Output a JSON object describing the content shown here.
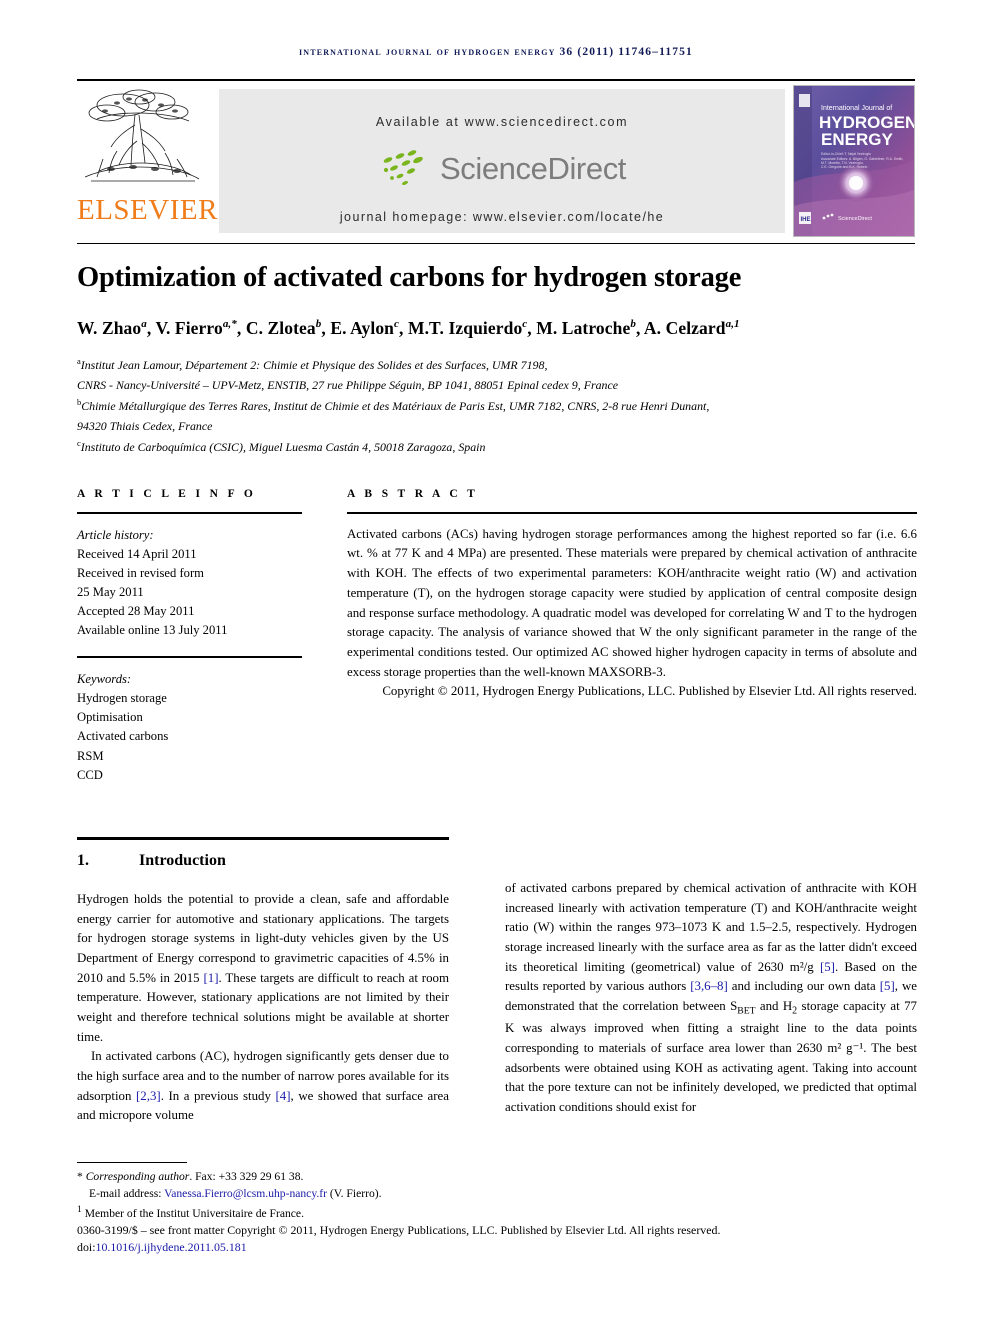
{
  "running_head": "International Journal of Hydrogen Energy 36 (2011) 11746–11751",
  "masthead": {
    "publisher": "ELSEVIER",
    "available_at": "Available at www.sciencedirect.com",
    "sciencedirect": "ScienceDirect",
    "journal_homepage": "journal homepage: www.elsevier.com/locate/he",
    "cover": {
      "line1": "International Journal of",
      "line2": "HYDROGEN",
      "line3": "ENERGY",
      "editor_label": "Editor-in-Chief:",
      "editor": "T. Nejat Veziroglu",
      "assoc_label": "Associate Editors:",
      "assoc": "A. Bilgen, G. Gahleitner, R.A. Smith, M.T. Moretto, T.N. Veziroglu, C.E. Gregoire and B.K. Rebelo",
      "sd_mark": "ScienceDirect"
    }
  },
  "colors": {
    "elsevier_orange": "#f07d1a",
    "sciencedirect_green": "#7ab51d",
    "sciencedirect_gray": "#7d7d7d",
    "link_blue": "#1a1aa8",
    "running_head_navy": "#101a57",
    "banner_gray": "#e9e9e9"
  },
  "article": {
    "title": "Optimization of activated carbons for hydrogen storage",
    "authors_html": "W. Zhao<sup>a</sup>, V. Fierro<sup>a,*</sup>, C. Zlotea<sup>b</sup>, E. Aylon<sup>c</sup>, M.T. Izquierdo<sup>c</sup>, M. Latroche<sup>b</sup>, A. Celzard<sup>a,1</sup>",
    "affiliations": [
      "<sup>a</sup>Institut Jean Lamour, Département 2: Chimie et Physique des Solides et des Surfaces, UMR 7198,",
      "CNRS - Nancy-Université – UPV-Metz, ENSTIB, 27 rue Philippe Séguin, BP 1041, 88051 Epinal cedex 9, France",
      "<sup>b</sup>Chimie Métallurgique des Terres Rares, Institut de Chimie et des Matériaux de Paris Est, UMR 7182, CNRS, 2-8 rue Henri Dunant,",
      "94320 Thiais Cedex, France",
      "<sup>c</sup>Instituto de Carboquímica (CSIC), Miguel Luesma Castán 4, 50018 Zaragoza, Spain"
    ]
  },
  "article_info": {
    "heading": "A R T I C L E  I N F O",
    "history_label": "Article history:",
    "history": [
      "Received 14 April 2011",
      "Received in revised form",
      "25 May 2011",
      "Accepted 28 May 2011",
      "Available online 13 July 2011"
    ],
    "keywords_label": "Keywords:",
    "keywords": [
      "Hydrogen storage",
      "Optimisation",
      "Activated carbons",
      "RSM",
      "CCD"
    ]
  },
  "abstract": {
    "heading": "A B S T R A C T",
    "text": "Activated carbons (ACs) having hydrogen storage performances among the highest reported so far (i.e. 6.6 wt. % at 77 K and 4 MPa) are presented. These materials were prepared by chemical activation of anthracite with KOH. The effects of two experimental parameters: KOH/anthracite weight ratio (W) and activation temperature (T), on the hydrogen storage capacity were studied by application of central composite design and response surface methodology. A quadratic model was developed for correlating W and T to the hydrogen storage capacity. The analysis of variance showed that W the only significant parameter in the range of the experimental conditions tested. Our optimized AC showed higher hydrogen capacity in terms of absolute and excess storage properties than the well-known MAXSORB-3.",
    "copyright": "Copyright © 2011, Hydrogen Energy Publications, LLC. Published by Elsevier Ltd. All rights reserved."
  },
  "section": {
    "number": "1.",
    "name": "Introduction"
  },
  "body": {
    "left_paragraph_1": "Hydrogen holds the potential to provide a clean, safe and affordable energy carrier for automotive and stationary applications. The targets for hydrogen storage systems in light-duty vehicles given by the US Department of Energy correspond to gravimetric capacities of 4.5% in 2010 and 5.5% in 2015 [1]. These targets are difficult to reach at room temperature. However, stationary applications are not limited by their weight and therefore technical solutions might be available at shorter time.",
    "left_paragraph_2": "In activated carbons (AC), hydrogen significantly gets denser due to the high surface area and to the number of narrow pores available for its adsorption [2,3]. In a previous study [4], we showed that surface area and micropore volume",
    "right_paragraph_1": "of activated carbons prepared by chemical activation of anthracite with KOH increased linearly with activation temperature (T) and KOH/anthracite weight ratio (W) within the ranges 973–1073 K and 1.5–2.5, respectively. Hydrogen storage increased linearly with the surface area as far as the latter didn't exceed its theoretical limiting (geometrical) value of 2630 m²/g [5]. Based on the results reported by various authors [3,6–8] and including our own data [5], we demonstrated that the correlation between SBET and H2 storage capacity at 77 K was always improved when fitting a straight line to the data points corresponding to materials of surface area lower than 2630 m² g⁻¹. The best adsorbents were obtained using KOH as activating agent. Taking into account that the pore texture can not be infinitely developed, we predicted that optimal activation conditions should exist for",
    "citations": [
      "[1]",
      "[2,3]",
      "[4]",
      "[5]",
      "[3,6–8]"
    ]
  },
  "footnotes": {
    "corresponding": "* Corresponding author. Fax: +33 329 29 61 38.",
    "email_label": "E-mail address:",
    "email": "Vanessa.Fierro@lcsm.uhp-nancy.fr",
    "email_suffix": "(V. Fierro).",
    "member_note": "1 Member of the Institut Universitaire de France."
  },
  "imprint": {
    "issn_line": "0360-3199/$ – see front matter Copyright © 2011, Hydrogen Energy Publications, LLC. Published by Elsevier Ltd. All rights reserved.",
    "doi_label": "doi:",
    "doi": "10.1016/j.ijhydene.2011.05.181"
  }
}
